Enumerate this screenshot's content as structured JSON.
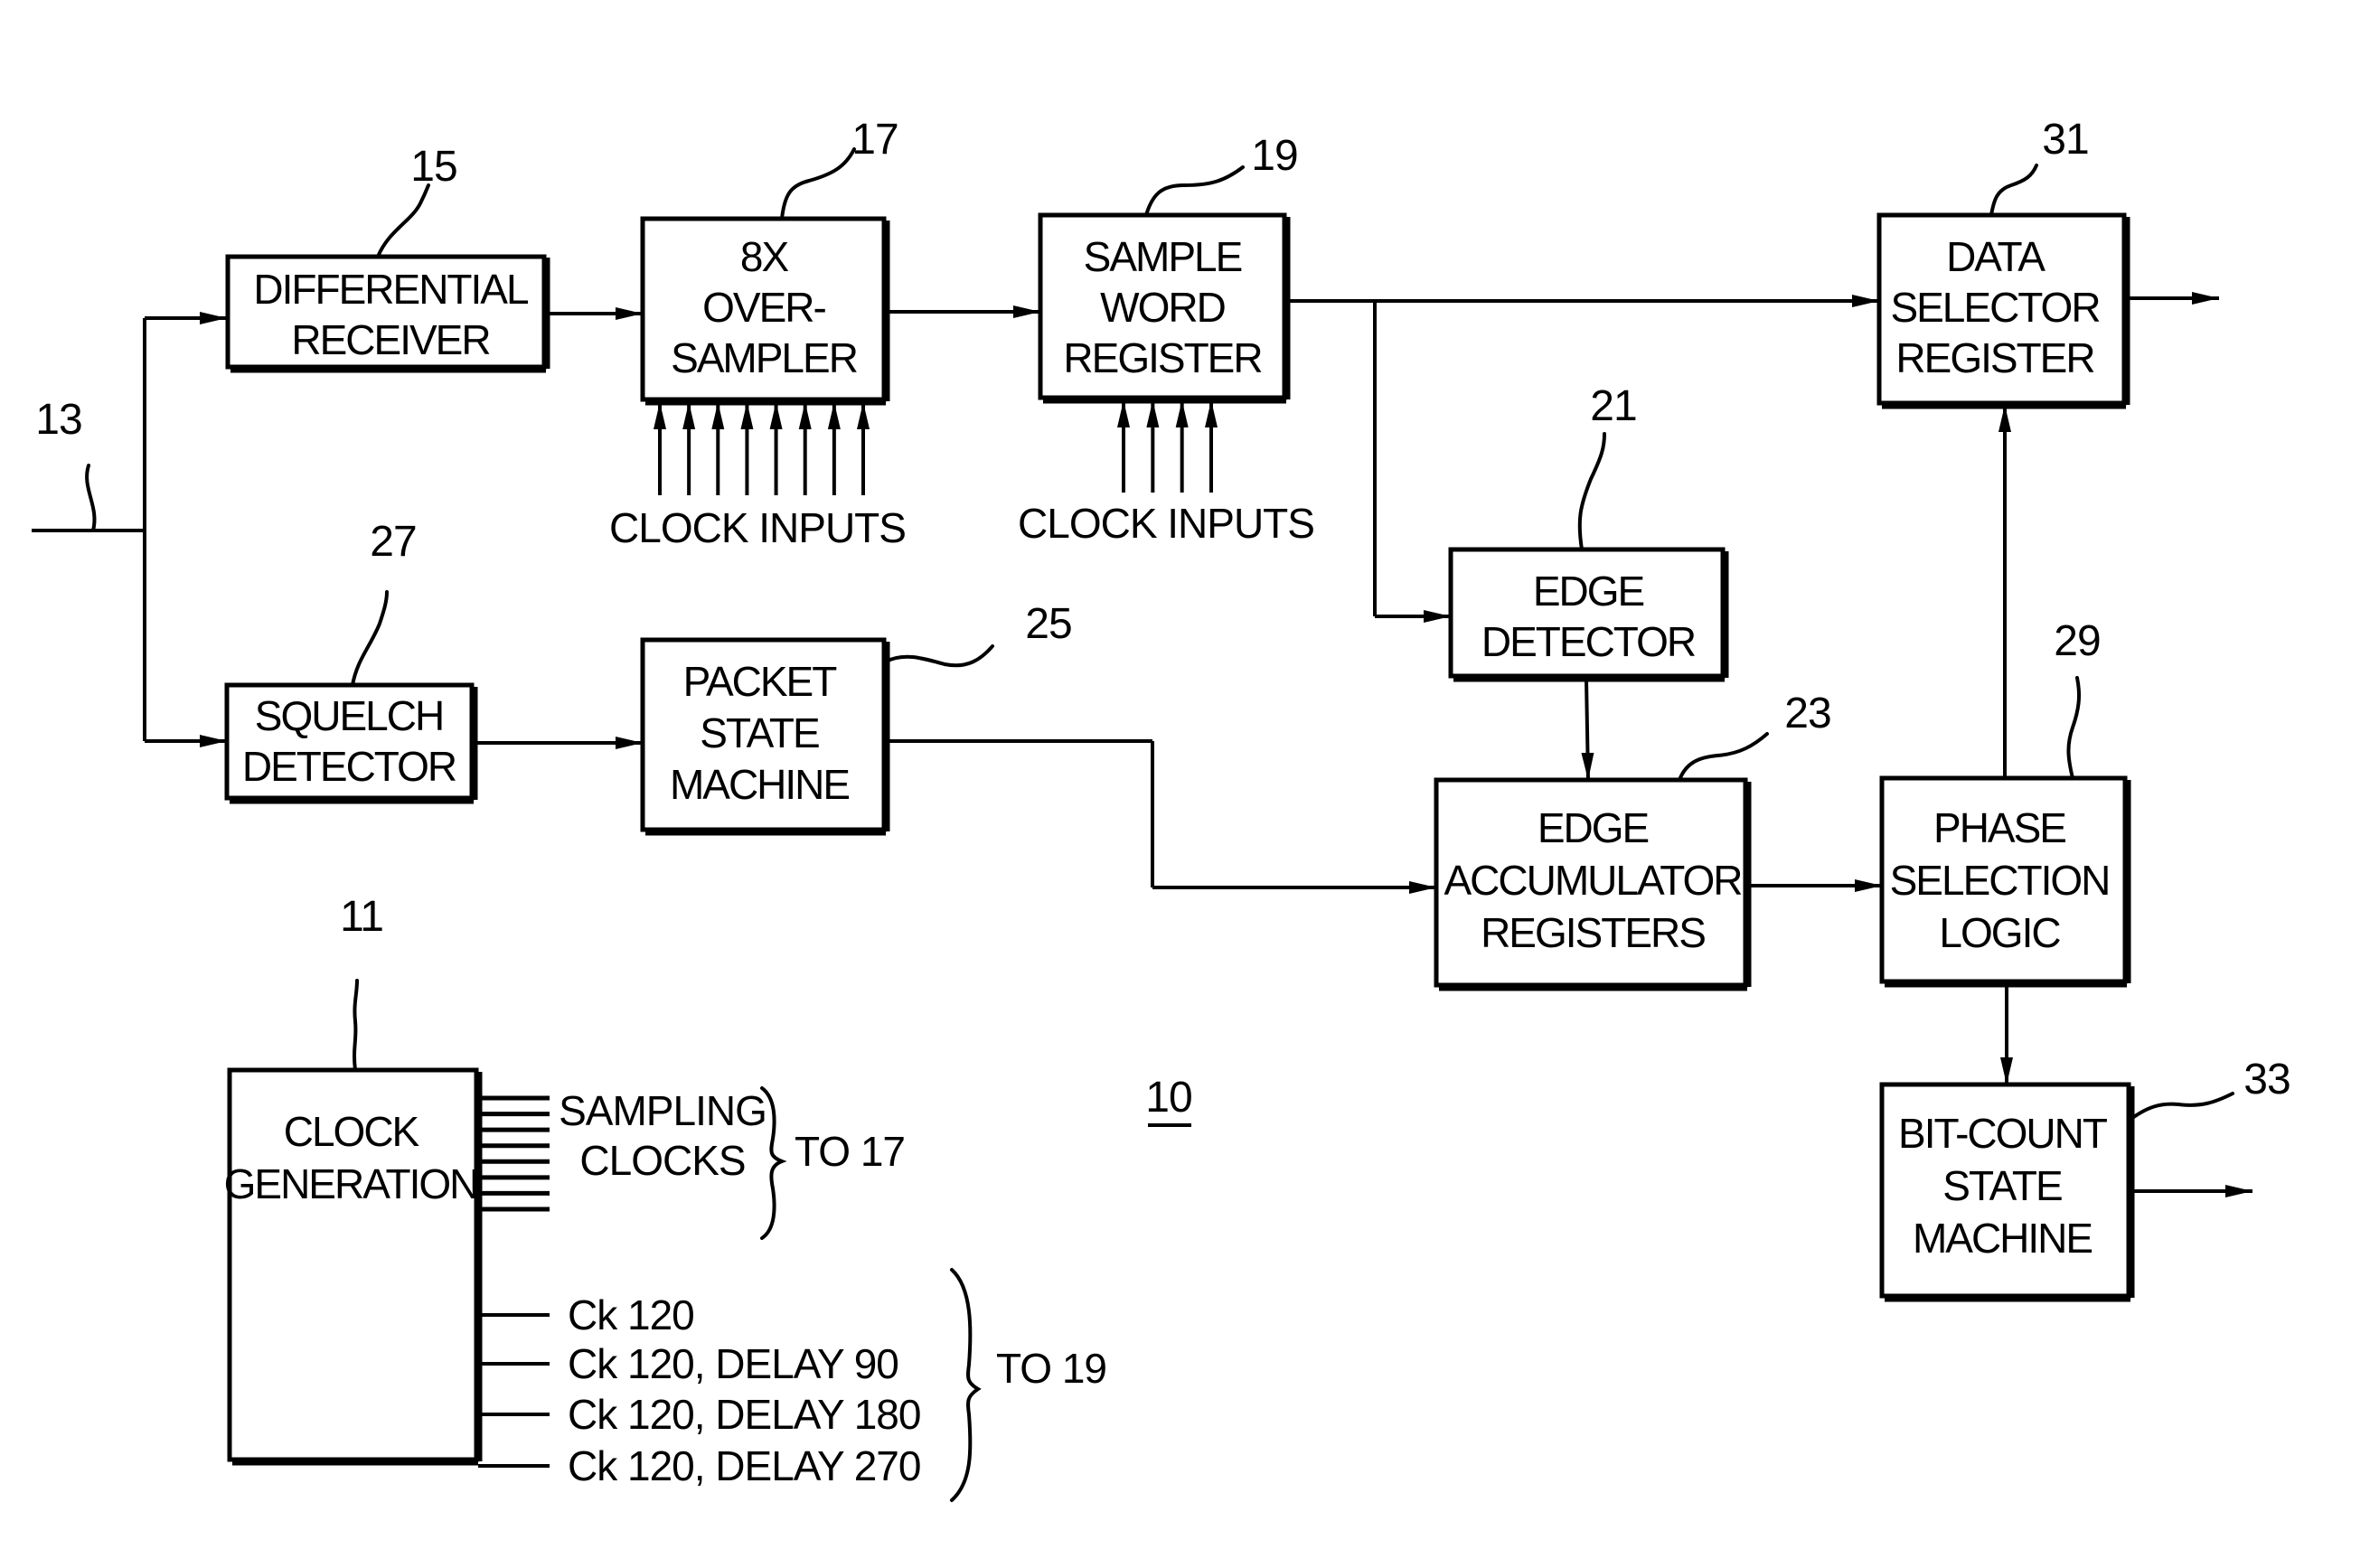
{
  "figure_number": "10",
  "input_line_ref": "13",
  "blocks": {
    "differential_receiver": {
      "ref": "15",
      "lines": [
        "DIFFERENTIAL",
        "RECEIVER"
      ]
    },
    "over_sampler": {
      "ref": "17",
      "lines": [
        "8X",
        "OVER-",
        "SAMPLER"
      ]
    },
    "sample_word_register": {
      "ref": "19",
      "lines": [
        "SAMPLE",
        "WORD",
        "REGISTER"
      ]
    },
    "data_selector_register": {
      "ref": "31",
      "lines": [
        "DATA",
        "SELECTOR",
        "REGISTER"
      ]
    },
    "squelch_detector": {
      "ref": "27",
      "lines": [
        "SQUELCH",
        "DETECTOR"
      ]
    },
    "packet_state_machine": {
      "ref": "25",
      "lines": [
        "PACKET",
        "STATE",
        "MACHINE"
      ]
    },
    "edge_detector": {
      "ref": "21",
      "lines": [
        "EDGE",
        "DETECTOR"
      ]
    },
    "edge_accumulator_registers": {
      "ref": "23",
      "lines": [
        "EDGE",
        "ACCUMULATOR",
        "REGISTERS"
      ]
    },
    "phase_selection_logic": {
      "ref": "29",
      "lines": [
        "PHASE",
        "SELECTION",
        "LOGIC"
      ]
    },
    "bit_count_state_machine": {
      "ref": "33",
      "lines": [
        "BIT-COUNT",
        "STATE",
        "MACHINE"
      ]
    },
    "clock_generation": {
      "ref": "11",
      "lines": [
        "CLOCK",
        "GENERATION"
      ]
    }
  },
  "clock_inputs_oversampler": {
    "label": "CLOCK  INPUTS",
    "count": 8
  },
  "clock_inputs_register": {
    "label": "CLOCK  INPUTS",
    "count": 4
  },
  "sampling_clocks": {
    "lines": [
      "SAMPLING",
      "CLOCKS"
    ],
    "target": "TO  17",
    "count": 8
  },
  "clock_outputs": {
    "items": [
      "Ck  120",
      "Ck  120,  DELAY  90",
      "Ck  120,  DELAY  180",
      "Ck  120,  DELAY  270"
    ],
    "target": "TO  19"
  }
}
